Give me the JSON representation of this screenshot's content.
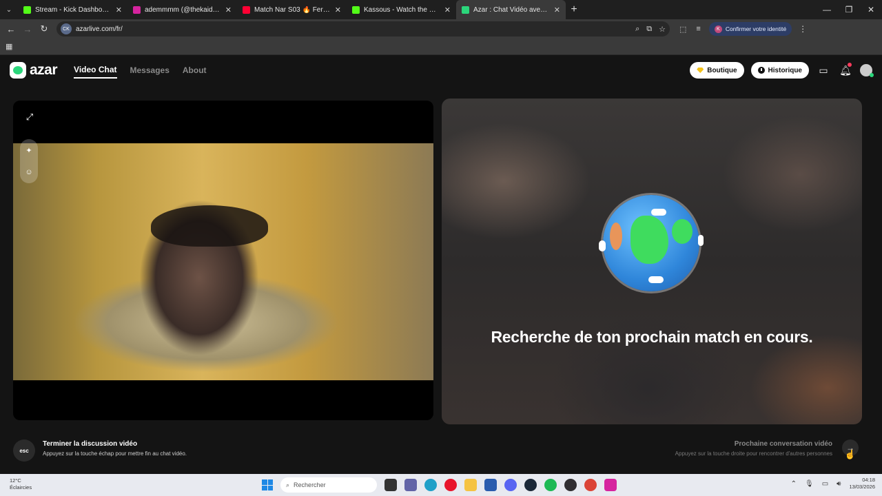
{
  "browser": {
    "tabs": [
      {
        "label": "Stream - Kick Dashboard",
        "color": "#53fc18",
        "active": false
      },
      {
        "label": "ademmmm (@thekaido_) • Pho",
        "color": "#d6249f",
        "active": false
      },
      {
        "label": "Match Nar S03 🔥 Feriel Yous",
        "color": "#ff0033",
        "active": false
      },
      {
        "label": "Kassous - Watch the VOD on K",
        "color": "#53fc18",
        "active": false
      },
      {
        "label": "Azar : Chat Vidéo avec de n",
        "color": "#2bd67b",
        "active": true
      }
    ],
    "url": "azarlive.com/fr/",
    "site_badge": "CK",
    "identity_label": "Confirmer votre identité",
    "identity_initial": "K"
  },
  "app": {
    "logo_text": "azar",
    "nav": {
      "video_chat": "Video Chat",
      "messages": "Messages",
      "about": "About"
    },
    "shop_label": "Boutique",
    "history_label": "Historique"
  },
  "match": {
    "status_text": "Recherche de ton prochain match en cours."
  },
  "controls": {
    "esc_key": "esc",
    "end_title": "Terminer la discussion vidéo",
    "end_sub": "Appuyez sur la touche échap pour mettre fin au chat vidéo.",
    "next_title": "Prochaine conversation vidéo",
    "next_sub": "Appuyez sur la touche droite pour rencontrer d'autres personnes"
  },
  "taskbar": {
    "weather_temp": "12°C",
    "weather_desc": "Éclaircies",
    "search_placeholder": "Rechercher",
    "time": "04:18",
    "date": "13/03/2026"
  }
}
